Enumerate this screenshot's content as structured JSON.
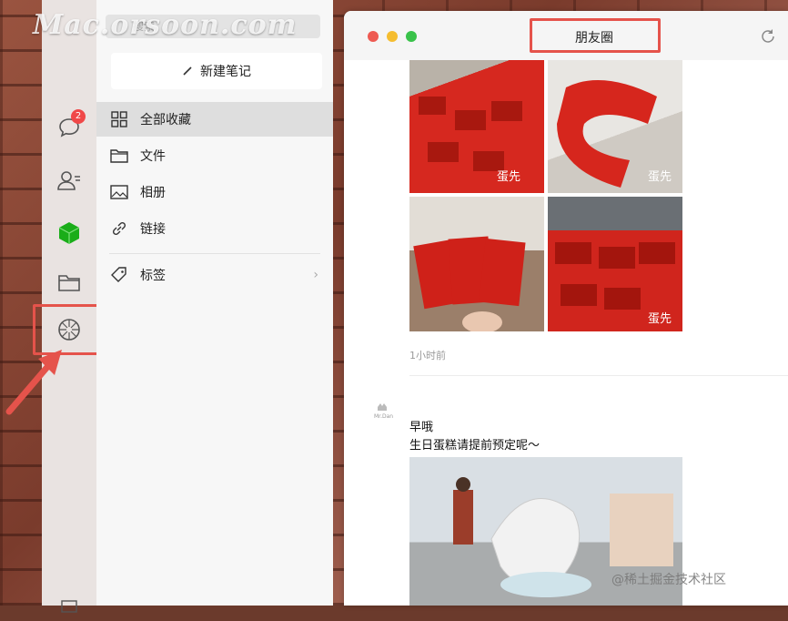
{
  "watermark": "Mac.orsoon.com",
  "iconbar": {
    "chat_badge": "2",
    "items": [
      "chat-icon",
      "contacts-icon",
      "favorites-cube-icon",
      "files-folder-icon",
      "moments-aperture-icon"
    ]
  },
  "favpanel": {
    "search_placeholder": "搜索",
    "new_note_label": "新建笔记",
    "items": [
      {
        "label": "全部收藏",
        "icon": "grid-icon"
      },
      {
        "label": "文件",
        "icon": "folder-icon"
      },
      {
        "label": "相册",
        "icon": "image-icon"
      },
      {
        "label": "链接",
        "icon": "link-icon"
      }
    ],
    "tags_label": "标签"
  },
  "moments": {
    "title": "朋友圈",
    "post1": {
      "time": "1小时前"
    },
    "post2": {
      "line1": "早哦",
      "line2": "生日蛋糕请提前预定呢～"
    }
  },
  "colors": {
    "highlight": "#e5534b",
    "badge": "#f04848",
    "accent_green": "#1aad19"
  },
  "footer_watermark": "@稀土掘金技术社区"
}
